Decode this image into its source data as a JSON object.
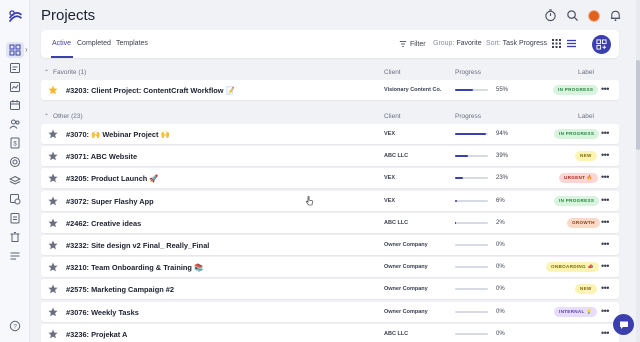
{
  "page": {
    "title": "Projects"
  },
  "nav": {
    "items": [
      "dashboard",
      "projects",
      "reports",
      "calendar",
      "people",
      "invoices",
      "goals",
      "stack",
      "timesheets",
      "tasks",
      "trash",
      "settings"
    ]
  },
  "tabs": [
    {
      "label": "Active",
      "active": true
    },
    {
      "label": "Completed",
      "active": false
    },
    {
      "label": "Templates",
      "active": false
    }
  ],
  "toolbar": {
    "filter_label": "Filter",
    "group_prefix": "Group:",
    "group_value": "Favorite",
    "sort_prefix": "Sort:",
    "sort_value": "Task Progress"
  },
  "columns": {
    "client": "Client",
    "progress": "Progress",
    "label": "Label"
  },
  "groups": [
    {
      "name": "Favorite (1)",
      "rows": [
        {
          "name": "#3203: Client Project: ContentCraft Workflow 📝",
          "favorite": true,
          "client": "Visionary Content Co.",
          "progress": 55,
          "progress_text": "55%",
          "label": "IN PROGRESS",
          "label_color": "#1f8a3c",
          "label_bg": "#d9f3df"
        }
      ]
    },
    {
      "name": "Other (23)",
      "rows": [
        {
          "name": "#3070: 🙌 Webinar Project 🙌",
          "favorite": false,
          "client": "VEX",
          "progress": 94,
          "progress_text": "94%",
          "label": "IN PROGRESS",
          "label_color": "#1f8a3c",
          "label_bg": "#d9f3df"
        },
        {
          "name": "#3071: ABC Website",
          "favorite": false,
          "client": "ABC LLC",
          "progress": 39,
          "progress_text": "39%",
          "label": "NEW",
          "label_color": "#7a6a00",
          "label_bg": "#fdf4b3"
        },
        {
          "name": "#3205: Product Launch 🚀",
          "favorite": false,
          "client": "VEX",
          "progress": 23,
          "progress_text": "23%",
          "label": "URGENT 🔥",
          "label_color": "#b3261e",
          "label_bg": "#fbd6d3"
        },
        {
          "name": "#3072: Super Flashy App",
          "favorite": false,
          "client": "VEX",
          "progress": 6,
          "progress_text": "6%",
          "label": "IN PROGRESS",
          "label_color": "#1f8a3c",
          "label_bg": "#d9f3df"
        },
        {
          "name": "#2462: Creative ideas",
          "favorite": false,
          "client": "ABC LLC",
          "progress": 2,
          "progress_text": "2%",
          "label": "GROWTH",
          "label_color": "#9a3412",
          "label_bg": "#fbd9c7"
        },
        {
          "name": "#3232: Site design v2 Final_ Really_Final",
          "favorite": false,
          "client": "Owner Company",
          "progress": 0,
          "progress_text": "0%",
          "label": "",
          "label_color": "#000000",
          "label_bg": "transparent"
        },
        {
          "name": "#3210: Team Onboarding & Training 📚",
          "favorite": false,
          "client": "Owner Company",
          "progress": 0,
          "progress_text": "0%",
          "label": "ONBOARDING 📣",
          "label_color": "#7a6a00",
          "label_bg": "#fdf4b3"
        },
        {
          "name": "#2575: Marketing Campaign #2",
          "favorite": false,
          "client": "Owner Company",
          "progress": 0,
          "progress_text": "0%",
          "label": "NEW",
          "label_color": "#7a6a00",
          "label_bg": "#fdf4b3"
        },
        {
          "name": "#3076: Weekly Tasks",
          "favorite": false,
          "client": "Owner Company",
          "progress": 0,
          "progress_text": "0%",
          "label": "INTERNAL 💡",
          "label_color": "#5b3fa8",
          "label_bg": "#e6dcfb"
        },
        {
          "name": "#3236: Projekat A",
          "favorite": false,
          "client": "ABC LLC",
          "progress": 0,
          "progress_text": "0%",
          "label": "",
          "label_color": "#000000",
          "label_bg": "transparent"
        }
      ]
    }
  ],
  "colors": {
    "accent": "#3b3fae",
    "favorite_star": "#f5b731",
    "star_default": "#6a6f82"
  }
}
